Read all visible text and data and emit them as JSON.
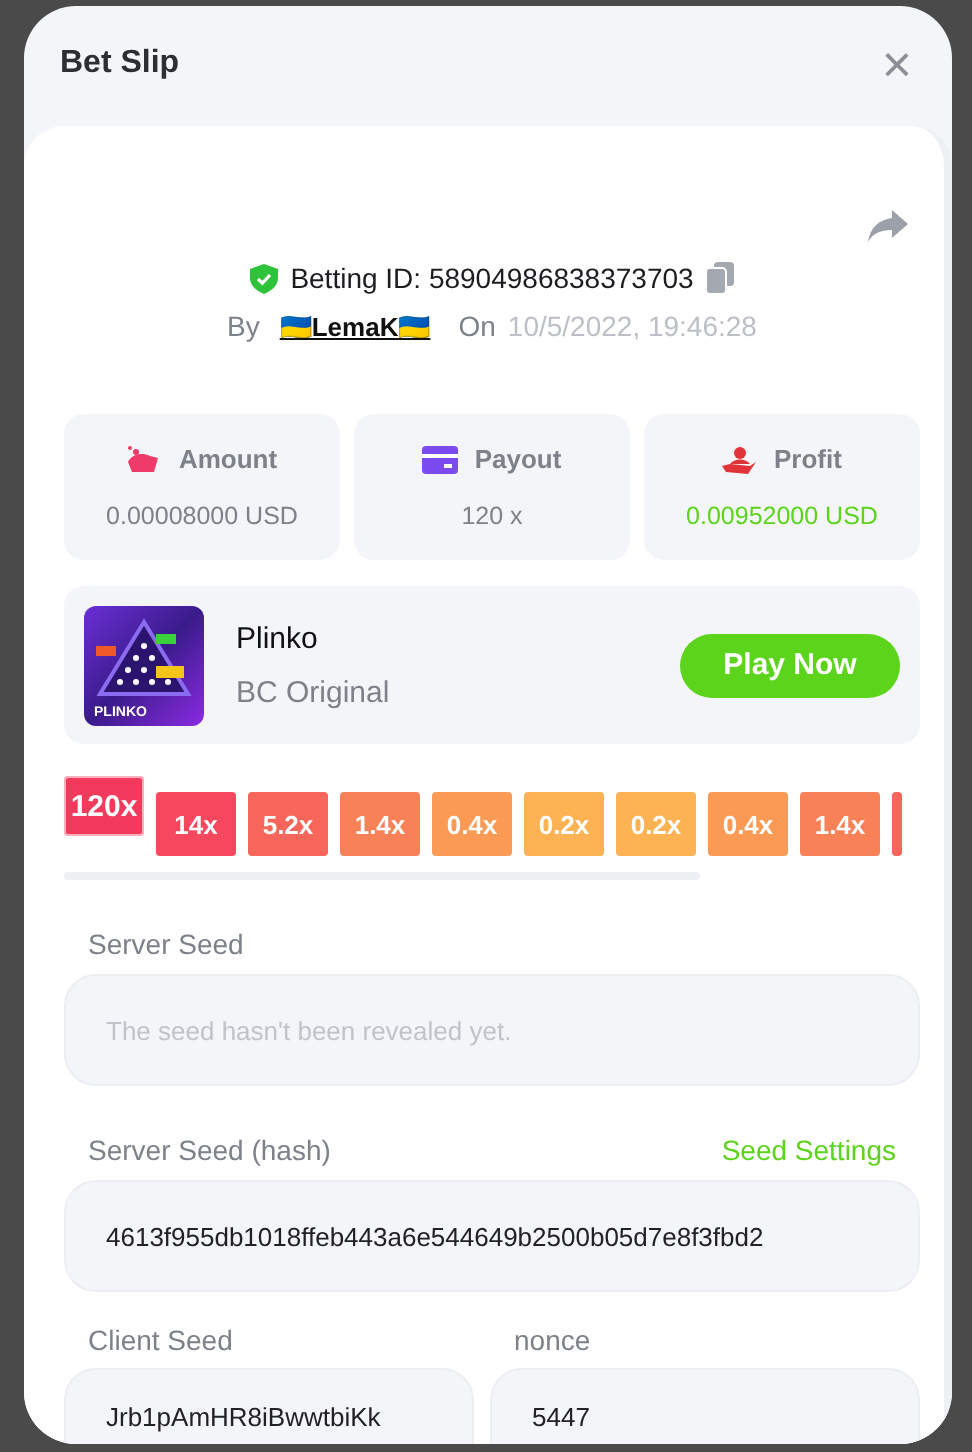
{
  "dialog": {
    "title": "Bet Slip",
    "close": "×"
  },
  "bet": {
    "id_label": "Betting ID: 58904986838373703",
    "by_label": "By",
    "user": "🇺🇦LemaK🇺🇦",
    "on_label": "On",
    "date": "10/5/2022, 19:46:28"
  },
  "stats": [
    {
      "kind": "amount",
      "label": "Amount",
      "value": "0.00008000 USD",
      "positive": false
    },
    {
      "kind": "payout",
      "label": "Payout",
      "value": "120 x",
      "positive": false
    },
    {
      "kind": "profit",
      "label": "Profit",
      "value": "0.00952000 USD",
      "positive": true
    }
  ],
  "game": {
    "name": "Plinko",
    "provider": "BC Original",
    "thumb_label": "PLINKO",
    "play_button": "Play Now"
  },
  "multipliers": [
    {
      "label": "120x",
      "color": "#f43a5c",
      "selected": true
    },
    {
      "label": "14x",
      "color": "#f5475d",
      "selected": false
    },
    {
      "label": "5.2x",
      "color": "#f6665a",
      "selected": false
    },
    {
      "label": "1.4x",
      "color": "#f88157",
      "selected": false
    },
    {
      "label": "0.4x",
      "color": "#fa9a55",
      "selected": false
    },
    {
      "label": "0.2x",
      "color": "#fdb353",
      "selected": false
    },
    {
      "label": "0.2x",
      "color": "#fdb353",
      "selected": false
    },
    {
      "label": "0.4x",
      "color": "#fa9a55",
      "selected": false
    },
    {
      "label": "1.4x",
      "color": "#f88157",
      "selected": false
    },
    {
      "color": "#f6665a",
      "selected": false
    }
  ],
  "server_seed": {
    "label": "Server Seed",
    "placeholder": "The seed hasn't been revealed yet."
  },
  "server_seed_hash": {
    "label": "Server Seed (hash)",
    "link": "Seed Settings",
    "value": "4613f955db1018ffeb443a6e544649b2500b05d7e8f3fbd2"
  },
  "client_seed": {
    "label": "Client Seed",
    "value": "Jrb1pAmHR8iBwwtbiKk"
  },
  "nonce": {
    "label": "nonce",
    "value": "5447"
  }
}
